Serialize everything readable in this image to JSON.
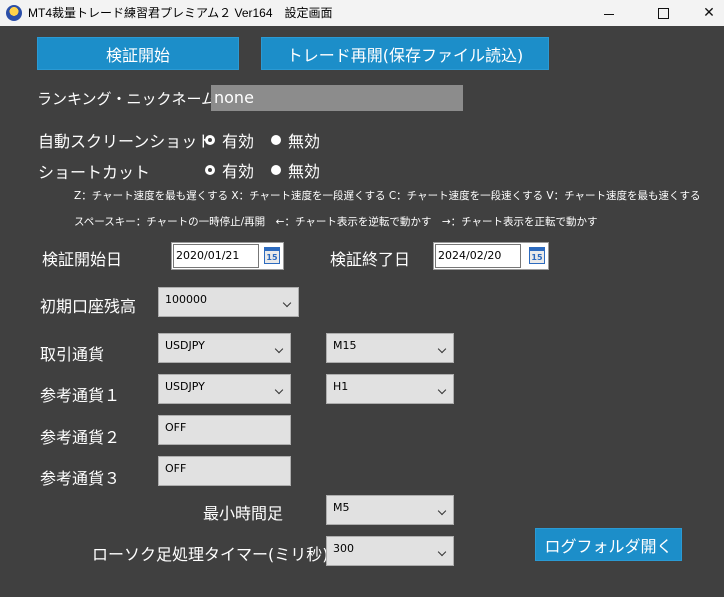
{
  "window": {
    "title": "MT4裁量トレード練習君プレミアム２ Ver164　設定画面"
  },
  "buttons": {
    "start_verify": "検証開始",
    "resume_trade": "トレード再開(保存ファイル読込)",
    "open_log_folder": "ログフォルダ開く"
  },
  "nickname": {
    "label": "ランキング・ニックネーム",
    "value": "none"
  },
  "auto_screenshot": {
    "label": "自動スクリーンショット",
    "on": "有効",
    "off": "無効"
  },
  "shortcut": {
    "label": "ショートカット",
    "on": "有効",
    "off": "無効"
  },
  "help": {
    "line1": "Z：チャート速度を最も遅くする X：チャート速度を一段遅くする C：チャート速度を一段速くする V：チャート速度を最も速くする",
    "line2": "スペースキー：チャートの一時停止/再開　←：チャート表示を逆転で動かす　→：チャート表示を正転で動かす"
  },
  "dates": {
    "start_label": "検証開始日",
    "start_value": "2020/01/21",
    "end_label": "検証終了日",
    "end_value": "2024/02/20",
    "calendar_glyph": "15"
  },
  "balance": {
    "label": "初期口座残高",
    "value": "100000"
  },
  "currency": {
    "label": "取引通貨",
    "symbol": "USDJPY",
    "timeframe": "M15"
  },
  "ref1": {
    "label": "参考通貨１",
    "symbol": "USDJPY",
    "timeframe": "H1"
  },
  "ref2": {
    "label": "参考通貨２",
    "symbol": "OFF"
  },
  "ref3": {
    "label": "参考通貨３",
    "symbol": "OFF"
  },
  "min_timeframe": {
    "label": "最小時間足",
    "value": "M5"
  },
  "candle_timer": {
    "label": "ローソク足処理タイマー(ミリ秒)",
    "value": "300"
  },
  "colors": {
    "accent": "#1c8ec9",
    "background": "#404040"
  }
}
